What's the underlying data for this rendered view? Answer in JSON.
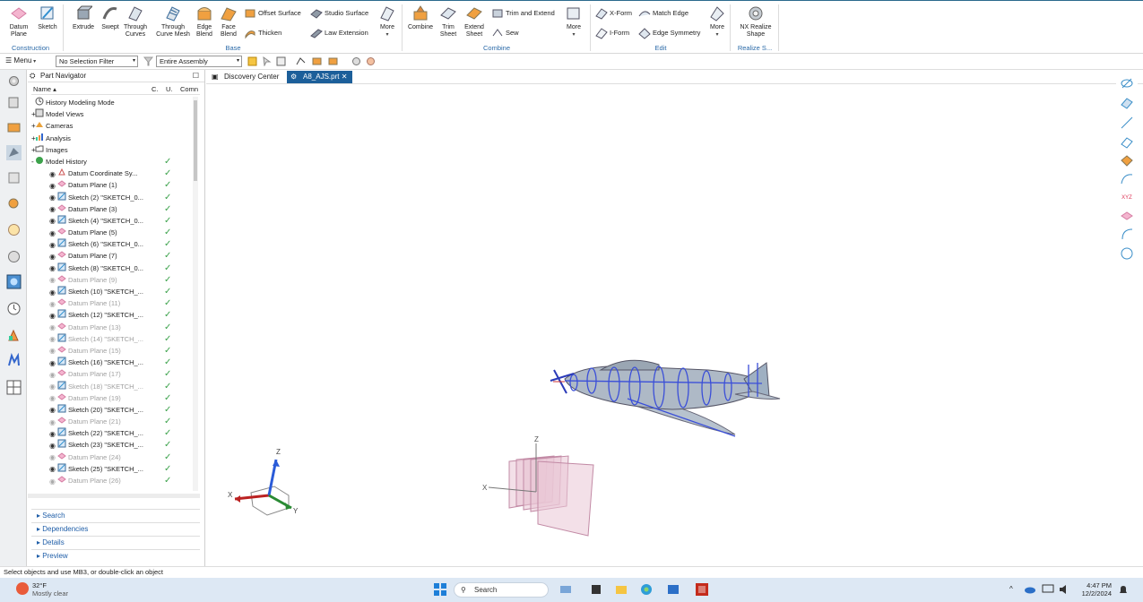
{
  "ribbon": {
    "construction": {
      "label": "Construction",
      "items": [
        "Datum Plane",
        "Sketch"
      ]
    },
    "base": {
      "label": "Base",
      "big": [
        "Extrude",
        "Swept",
        "Through Curves",
        "Through Curve Mesh",
        "Edge Blend",
        "Face Blend"
      ],
      "small": [
        "Offset Surface",
        "Studio Surface",
        "Thicken",
        "Law Extension"
      ],
      "more": "More"
    },
    "combine": {
      "label": "Combine",
      "big": [
        "Combine",
        "Trim Sheet",
        "Extend Sheet"
      ],
      "small": [
        "Trim and Extend",
        "Sew"
      ],
      "more": "More"
    },
    "edit": {
      "label": "Edit",
      "small": [
        "X-Form",
        "Match Edge",
        "I-Form",
        "Edge Symmetry"
      ],
      "more": "More"
    },
    "realize": {
      "label": "Realize S...",
      "big": "NX Realize Shape"
    }
  },
  "toolbar": {
    "menu": "Menu",
    "filter": "No Selection Filter",
    "scope": "Entire Assembly"
  },
  "navigator": {
    "title": "Part Navigator",
    "columns": [
      "Name",
      "C.",
      "U.",
      "Comn"
    ],
    "rows": [
      {
        "label": "History Modeling Mode",
        "kind": "clock",
        "level": 0,
        "check": false,
        "dim": false
      },
      {
        "label": "Model Views",
        "kind": "views",
        "level": 0,
        "check": false,
        "dim": false,
        "expand": "+"
      },
      {
        "label": "Cameras",
        "kind": "camera",
        "level": 0,
        "check": false,
        "dim": false,
        "expand": "+"
      },
      {
        "label": "Analysis",
        "kind": "analysis",
        "level": 0,
        "check": false,
        "dim": false,
        "expand": "+"
      },
      {
        "label": "Images",
        "kind": "folder",
        "level": 0,
        "check": false,
        "dim": false,
        "expand": "+"
      },
      {
        "label": "Model History",
        "kind": "history",
        "level": 0,
        "check": true,
        "dim": false,
        "expand": "-"
      },
      {
        "label": "Datum Coordinate Sy...",
        "kind": "csys",
        "level": 1,
        "check": true,
        "dim": false
      },
      {
        "label": "Datum Plane (1)",
        "kind": "plane",
        "level": 1,
        "check": true,
        "dim": false
      },
      {
        "label": "Sketch (2) \"SKETCH_0...",
        "kind": "sketch",
        "level": 1,
        "check": true,
        "dim": false
      },
      {
        "label": "Datum Plane (3)",
        "kind": "plane",
        "level": 1,
        "check": true,
        "dim": false
      },
      {
        "label": "Sketch (4) \"SKETCH_0...",
        "kind": "sketch",
        "level": 1,
        "check": true,
        "dim": false
      },
      {
        "label": "Datum Plane (5)",
        "kind": "plane",
        "level": 1,
        "check": true,
        "dim": false
      },
      {
        "label": "Sketch (6) \"SKETCH_0...",
        "kind": "sketch",
        "level": 1,
        "check": true,
        "dim": false
      },
      {
        "label": "Datum Plane (7)",
        "kind": "plane",
        "level": 1,
        "check": true,
        "dim": false
      },
      {
        "label": "Sketch (8) \"SKETCH_0...",
        "kind": "sketch",
        "level": 1,
        "check": true,
        "dim": false
      },
      {
        "label": "Datum Plane (9)",
        "kind": "plane",
        "level": 1,
        "check": true,
        "dim": true
      },
      {
        "label": "Sketch (10) \"SKETCH_...",
        "kind": "sketch",
        "level": 1,
        "check": true,
        "dim": false
      },
      {
        "label": "Datum Plane (11)",
        "kind": "plane",
        "level": 1,
        "check": true,
        "dim": true
      },
      {
        "label": "Sketch (12) \"SKETCH_...",
        "kind": "sketch",
        "level": 1,
        "check": true,
        "dim": false
      },
      {
        "label": "Datum Plane (13)",
        "kind": "plane",
        "level": 1,
        "check": true,
        "dim": true
      },
      {
        "label": "Sketch (14) \"SKETCH_...",
        "kind": "sketch",
        "level": 1,
        "check": true,
        "dim": true
      },
      {
        "label": "Datum Plane (15)",
        "kind": "plane",
        "level": 1,
        "check": true,
        "dim": true
      },
      {
        "label": "Sketch (16) \"SKETCH_...",
        "kind": "sketch",
        "level": 1,
        "check": true,
        "dim": false
      },
      {
        "label": "Datum Plane (17)",
        "kind": "plane",
        "level": 1,
        "check": true,
        "dim": true
      },
      {
        "label": "Sketch (18) \"SKETCH_...",
        "kind": "sketch",
        "level": 1,
        "check": true,
        "dim": true
      },
      {
        "label": "Datum Plane (19)",
        "kind": "plane",
        "level": 1,
        "check": true,
        "dim": true
      },
      {
        "label": "Sketch (20) \"SKETCH_...",
        "kind": "sketch",
        "level": 1,
        "check": true,
        "dim": false
      },
      {
        "label": "Datum Plane (21)",
        "kind": "plane",
        "level": 1,
        "check": true,
        "dim": true
      },
      {
        "label": "Sketch (22) \"SKETCH_...",
        "kind": "sketch",
        "level": 1,
        "check": true,
        "dim": false
      },
      {
        "label": "Sketch (23) \"SKETCH_...",
        "kind": "sketch",
        "level": 1,
        "check": true,
        "dim": false
      },
      {
        "label": "Datum Plane (24)",
        "kind": "plane",
        "level": 1,
        "check": true,
        "dim": true
      },
      {
        "label": "Sketch (25) \"SKETCH_...",
        "kind": "sketch",
        "level": 1,
        "check": true,
        "dim": false
      },
      {
        "label": "Datum Plane (26)",
        "kind": "plane",
        "level": 1,
        "check": true,
        "dim": true
      }
    ],
    "panels": [
      "Search",
      "Dependencies",
      "Details",
      "Preview"
    ]
  },
  "tabs": [
    {
      "label": "Discovery Center",
      "active": false
    },
    {
      "label": "A8_AJS.prt",
      "active": true
    }
  ],
  "viewport": {
    "triad_labels": {
      "x": "X",
      "y": "Y",
      "z": "Z"
    },
    "datum_triad_labels": {
      "x": "X",
      "z": "Z"
    },
    "xyz_tag": "XYZ"
  },
  "status": "Select objects and use MB3, or double-click an object",
  "taskbar": {
    "weather_temp": "32°F",
    "weather_desc": "Mostly clear",
    "search": "Search",
    "time": "4:47 PM",
    "date": "12/2/2024"
  },
  "colors": {
    "accent": "#1c5f9a",
    "group_label": "#2b6aa8",
    "check": "#3ca24b",
    "plane": "#d9a5bd",
    "sketch": "#3b4fd8",
    "body": "#aeb9c6"
  }
}
